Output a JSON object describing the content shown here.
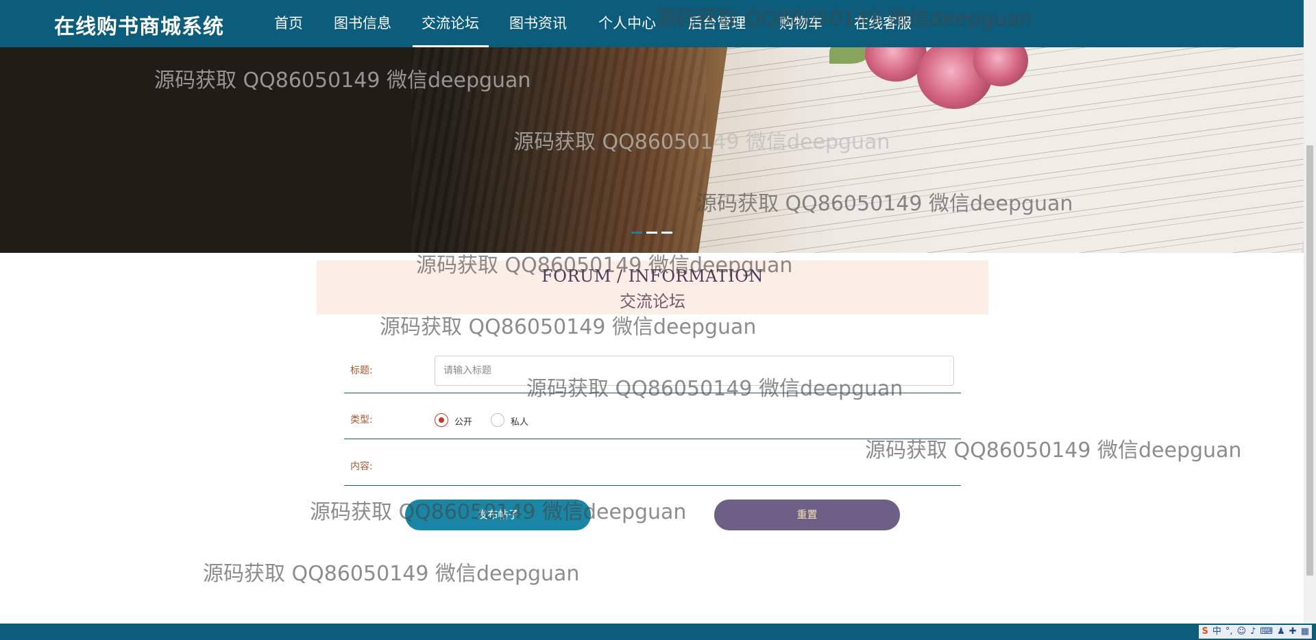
{
  "brand": "在线购书商城系统",
  "nav": {
    "items": [
      "首页",
      "图书信息",
      "交流论坛",
      "图书资讯",
      "个人中心",
      "后台管理",
      "购物车",
      "在线客服"
    ],
    "active_index": 2
  },
  "banner": {
    "slide_count": 3,
    "active_slide": 1
  },
  "section": {
    "title_en": "FORUM / INFORMATION",
    "title_zh": "交流论坛"
  },
  "form": {
    "title_label": "标题:",
    "title_placeholder": "请输入标题",
    "title_value": "",
    "type_label": "类型:",
    "type_options": [
      "公开",
      "私人"
    ],
    "type_selected": "公开",
    "content_label": "内容:",
    "submit_label": "发布帖子",
    "reset_label": "重置"
  },
  "watermark_text": "源码获取 QQ86050149 微信deepguan",
  "tray": {
    "icons": [
      "sogou-input-icon",
      "chinese-mode-icon",
      "punctuation-icon",
      "emoji-icon",
      "microphone-icon",
      "keyboard-icon",
      "user-icon",
      "skin-icon",
      "toolbox-icon"
    ],
    "ime_label": "中"
  },
  "colors": {
    "nav_bg": "#0c5c7c",
    "section_bg": "#fbeee6",
    "submit_bg": "#1a86a6",
    "reset_bg": "#6e5f86",
    "radio_checked": "#c0392b"
  }
}
